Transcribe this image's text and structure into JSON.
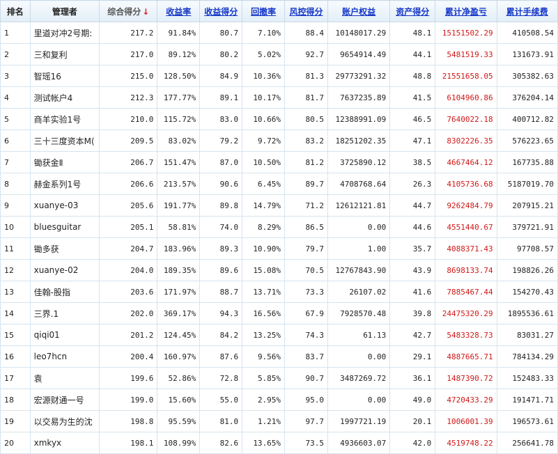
{
  "colors": {
    "link": "#1538c8",
    "profit_red": "#d01818",
    "header_bg": "#e3eef7"
  },
  "header": {
    "rank": "排名",
    "manager": "管理者",
    "score": "综合得分",
    "sort_arrow": "↓",
    "return_rate": "收益率",
    "return_score": "收益得分",
    "drawdown": "回撤率",
    "risk_score": "风控得分",
    "equity": "账户权益",
    "asset_score": "资产得分",
    "net_profit": "累计净盈亏",
    "fees": "累计手续费"
  },
  "rows": [
    [
      "1",
      "里道对冲2号期:",
      "217.2",
      "91.84%",
      "80.7",
      "7.10%",
      "88.4",
      "10148017.29",
      "48.1",
      "15151502.29",
      "410508.54"
    ],
    [
      "2",
      "三和复利",
      "217.0",
      "89.12%",
      "80.2",
      "5.02%",
      "92.7",
      "9654914.49",
      "44.1",
      "5481519.33",
      "131673.91"
    ],
    [
      "3",
      "智瑶16",
      "215.0",
      "128.50%",
      "84.9",
      "10.36%",
      "81.3",
      "29773291.32",
      "48.8",
      "21551658.05",
      "305382.63"
    ],
    [
      "4",
      "测试帐户4",
      "212.3",
      "177.77%",
      "89.1",
      "10.17%",
      "81.7",
      "7637235.89",
      "41.5",
      "6104960.86",
      "376204.14"
    ],
    [
      "5",
      "商羊实验1号",
      "210.0",
      "115.72%",
      "83.0",
      "10.66%",
      "80.5",
      "12388991.09",
      "46.5",
      "7640022.18",
      "400712.82"
    ],
    [
      "6",
      "三十三度资本M(",
      "209.5",
      "83.02%",
      "79.2",
      "9.72%",
      "83.2",
      "18251202.35",
      "47.1",
      "8302226.35",
      "576223.65"
    ],
    [
      "7",
      "锄获金Ⅱ",
      "206.7",
      "151.47%",
      "87.0",
      "10.50%",
      "81.2",
      "3725890.12",
      "38.5",
      "4667464.12",
      "167735.88"
    ],
    [
      "8",
      "赫金系列1号",
      "206.6",
      "213.57%",
      "90.6",
      "6.45%",
      "89.7",
      "4708768.64",
      "26.3",
      "4105736.68",
      "5187019.70"
    ],
    [
      "9",
      "xuanye-03",
      "205.6",
      "191.77%",
      "89.8",
      "14.79%",
      "71.2",
      "12612121.81",
      "44.7",
      "9262484.79",
      "207915.21"
    ],
    [
      "10",
      "bluesguitar",
      "205.1",
      "58.81%",
      "74.0",
      "8.29%",
      "86.5",
      "0.00",
      "44.6",
      "4551440.67",
      "379721.91"
    ],
    [
      "11",
      "锄多获",
      "204.7",
      "183.96%",
      "89.3",
      "10.90%",
      "79.7",
      "1.00",
      "35.7",
      "4088371.43",
      "97708.57"
    ],
    [
      "12",
      "xuanye-02",
      "204.0",
      "189.35%",
      "89.6",
      "15.08%",
      "70.5",
      "12767843.90",
      "43.9",
      "8698133.74",
      "198826.26"
    ],
    [
      "13",
      "佳翰-股指",
      "203.6",
      "171.97%",
      "88.7",
      "13.71%",
      "73.3",
      "26107.02",
      "41.6",
      "7885467.44",
      "154270.43"
    ],
    [
      "14",
      "三界.1",
      "202.0",
      "369.17%",
      "94.3",
      "16.56%",
      "67.9",
      "7928570.48",
      "39.8",
      "24475320.29",
      "1895536.61"
    ],
    [
      "15",
      "qiqi01",
      "201.2",
      "124.45%",
      "84.2",
      "13.25%",
      "74.3",
      "61.13",
      "42.7",
      "5483328.73",
      "83031.27"
    ],
    [
      "16",
      "leo7hcn",
      "200.4",
      "160.97%",
      "87.6",
      "9.56%",
      "83.7",
      "0.00",
      "29.1",
      "4887665.71",
      "784134.29"
    ],
    [
      "17",
      "袁",
      "199.6",
      "52.86%",
      "72.8",
      "5.85%",
      "90.7",
      "3487269.72",
      "36.1",
      "1487390.72",
      "152483.33"
    ],
    [
      "18",
      "宏源财通一号",
      "199.0",
      "15.60%",
      "55.0",
      "2.95%",
      "95.0",
      "0.00",
      "49.0",
      "4720433.29",
      "191471.71"
    ],
    [
      "19",
      "以交易为生的沈",
      "198.8",
      "95.59%",
      "81.0",
      "1.21%",
      "97.7",
      "1997721.19",
      "20.1",
      "1006001.39",
      "196573.61"
    ],
    [
      "20",
      "xmkyx",
      "198.1",
      "108.99%",
      "82.6",
      "13.65%",
      "73.5",
      "4936603.07",
      "42.0",
      "4519748.22",
      "256641.78"
    ]
  ]
}
